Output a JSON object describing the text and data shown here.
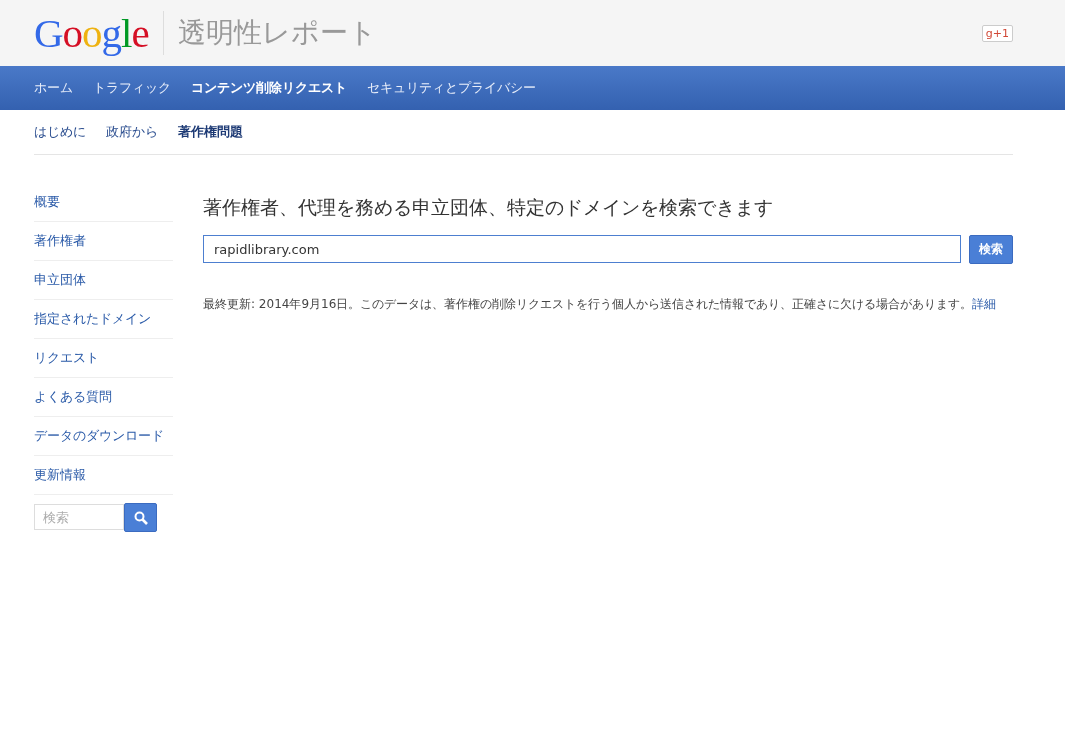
{
  "header": {
    "logo": "Google",
    "title": "透明性レポート",
    "plus_badge": "g+1"
  },
  "nav": [
    {
      "label": "ホーム",
      "selected": false
    },
    {
      "label": "トラフィック",
      "selected": false
    },
    {
      "label": "コンテンツ削除リクエスト",
      "selected": true
    },
    {
      "label": "セキュリティとプライバシー",
      "selected": false
    }
  ],
  "subnav": [
    {
      "label": "はじめに",
      "selected": false
    },
    {
      "label": "政府から",
      "selected": false
    },
    {
      "label": "著作権問題",
      "selected": true
    }
  ],
  "sidebar": {
    "items": [
      "概要",
      "著作権者",
      "申立団体",
      "指定されたドメイン",
      "リクエスト",
      "よくある質問",
      "データのダウンロード",
      "更新情報"
    ],
    "search_placeholder": "検索"
  },
  "main": {
    "heading": "著作権者、代理を務める申立団体、特定のドメインを検索できます",
    "search_value": "rapidlibrary.com",
    "search_button": "検索",
    "note": "最終更新: 2014年9月16日。このデータは、著作権の削除リクエストを行う個人から送信された情報であり、正確さに欠ける場合があります。",
    "note_link": "詳細"
  }
}
